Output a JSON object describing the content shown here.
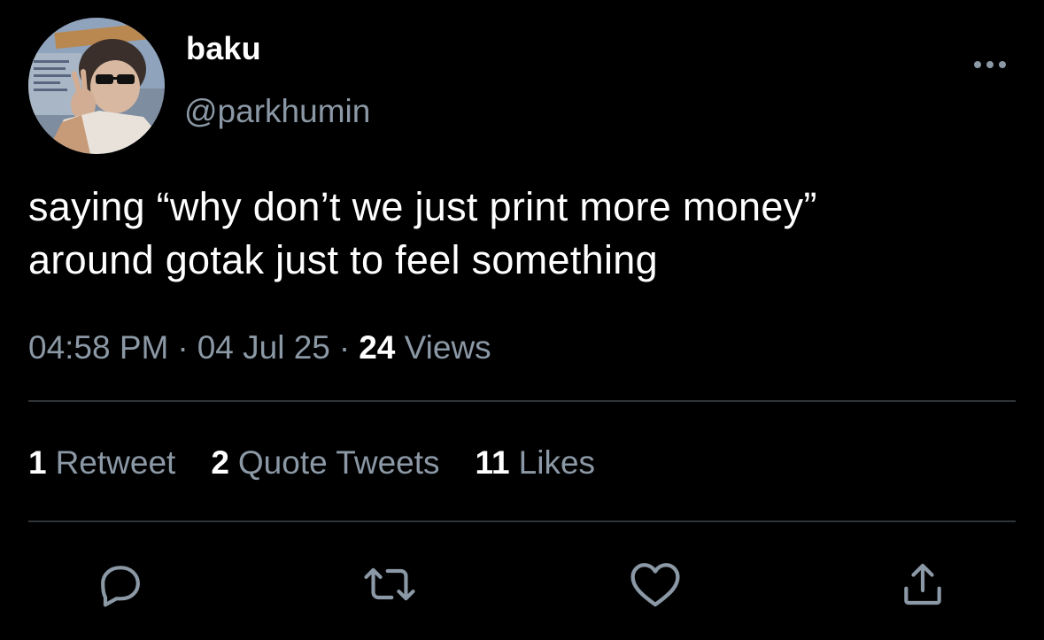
{
  "user": {
    "display_name": "baku",
    "handle": "@parkhumin",
    "avatar_icon": "user-avatar-photo"
  },
  "tweet": {
    "text_lines": [
      "saying “why don’t we just print more money”",
      "around gotak just to feel something"
    ],
    "time": "04:58 PM",
    "date": "04 Jul 25",
    "views_count": "24",
    "views_label": "Views"
  },
  "stats": {
    "retweets_count": "1",
    "retweets_label": "Retweet",
    "quotes_count": "2",
    "quotes_label": "Quote Tweets",
    "likes_count": "11",
    "likes_label": "Likes"
  },
  "actions": {
    "reply_icon": "reply-icon",
    "retweet_icon": "retweet-icon",
    "like_icon": "heart-icon",
    "share_icon": "share-icon",
    "more_icon": "more-options-icon"
  },
  "colors": {
    "background": "#000000",
    "primary_text": "#ffffff",
    "secondary_text": "#8b98a5",
    "divider": "#2f3336"
  }
}
